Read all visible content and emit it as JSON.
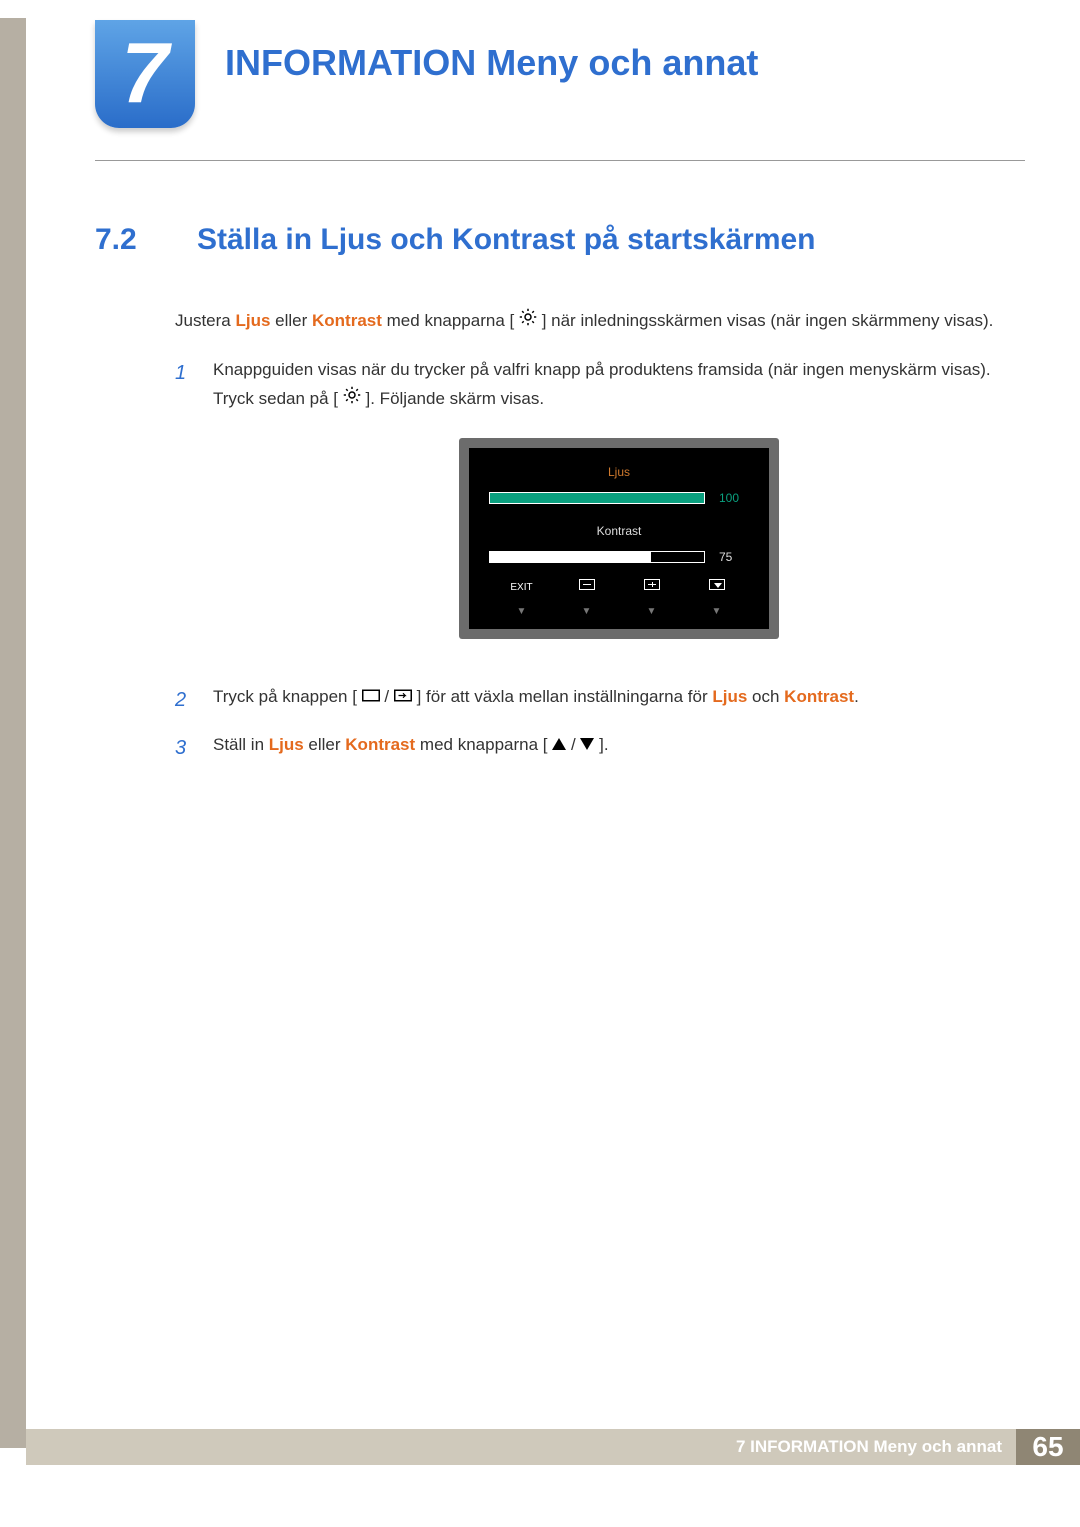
{
  "chapter": {
    "number": "7",
    "title": "INFORMATION Meny och annat"
  },
  "section": {
    "number": "7.2",
    "title": "Ställa in Ljus och Kontrast på startskärmen"
  },
  "intro": {
    "p1a": "Justera ",
    "kw_ljus": "Ljus",
    "p1b": " eller ",
    "kw_kontrast": "Kontrast",
    "p1c": " med knapparna [",
    "p1d": "] när inledningsskärmen visas (när ingen skärmmeny visas)."
  },
  "steps": [
    {
      "num": "1",
      "t1": "Knappguiden visas när du trycker på valfri knapp på produktens framsida (när ingen menyskärm visas). Tryck sedan på [",
      "t2": "]. Följande skärm visas."
    },
    {
      "num": "2",
      "t1": "Tryck på knappen [",
      "t2": "] för att växla mellan inställningarna för ",
      "kw1": "Ljus",
      "mid": " och ",
      "kw2": "Kontrast",
      "end": "."
    },
    {
      "num": "3",
      "t1": "Ställ in ",
      "kw1": "Ljus",
      "mid1": " eller ",
      "kw2": "Kontrast",
      "mid2": " med knapparna [",
      "end": "]."
    }
  ],
  "osd": {
    "row1": {
      "label": "Ljus",
      "value": "100",
      "fill": 100
    },
    "row2": {
      "label": "Kontrast",
      "value": "75",
      "fill": 75
    },
    "exit": "EXIT"
  },
  "footer": {
    "text": "7 INFORMATION Meny och annat",
    "page": "65"
  }
}
